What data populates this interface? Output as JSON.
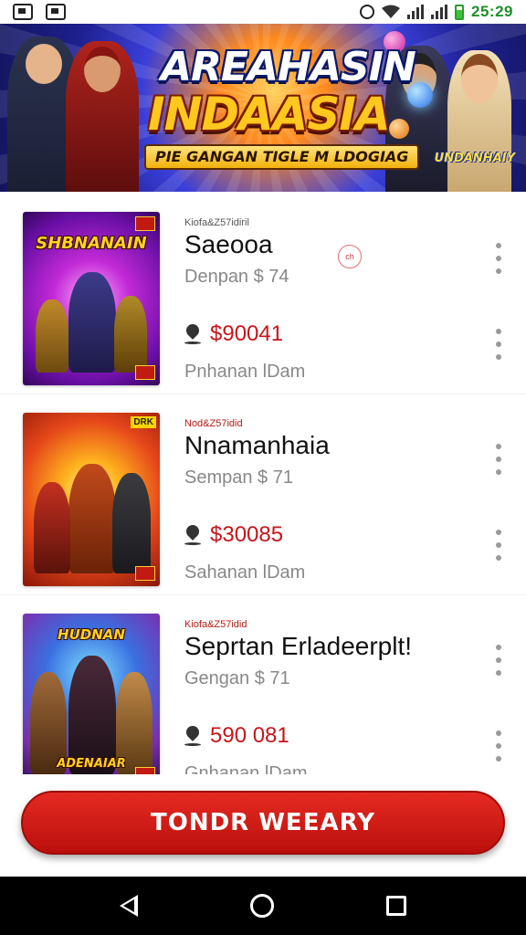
{
  "status_bar": {
    "time": "25:29"
  },
  "banner": {
    "title_line1": "AREAHASIN",
    "title_line2": "INDAASIA",
    "subtitle": "PIE GANGAN TIGLE M LDOGIAG",
    "badge": "UNDANHAIY"
  },
  "items": [
    {
      "meta": "Kiofa&Z57idiril",
      "title": "Saeooa",
      "subtitle": "Denpan $ 74",
      "price": "$90041",
      "location": "Pnhanan lDam",
      "badge": "ch",
      "thumb_logo": "SHBNANAIN",
      "thumb_tag": ""
    },
    {
      "meta": "Nod&Z57idid",
      "title": "Nnamanhaia",
      "subtitle": "Sempan $ 71",
      "price": "$30085",
      "location": "Sahanan lDam",
      "badge": "",
      "thumb_logo": "",
      "thumb_tag": "DRK"
    },
    {
      "meta": "Kiofa&Z57idid",
      "title": "Seprtan Erladeerplt!",
      "subtitle": "Gengan $ 71",
      "price": "590 081",
      "location": "Gnhanan lDam",
      "badge": "",
      "thumb_logo": "HUDNAN",
      "thumb_bottom_logo": "ADENAIAR",
      "thumb_tag": ""
    }
  ],
  "cta": {
    "label": "TONDR WEEARY"
  },
  "colors": {
    "accent": "#c8141a",
    "status_time": "#1f8f2a"
  }
}
